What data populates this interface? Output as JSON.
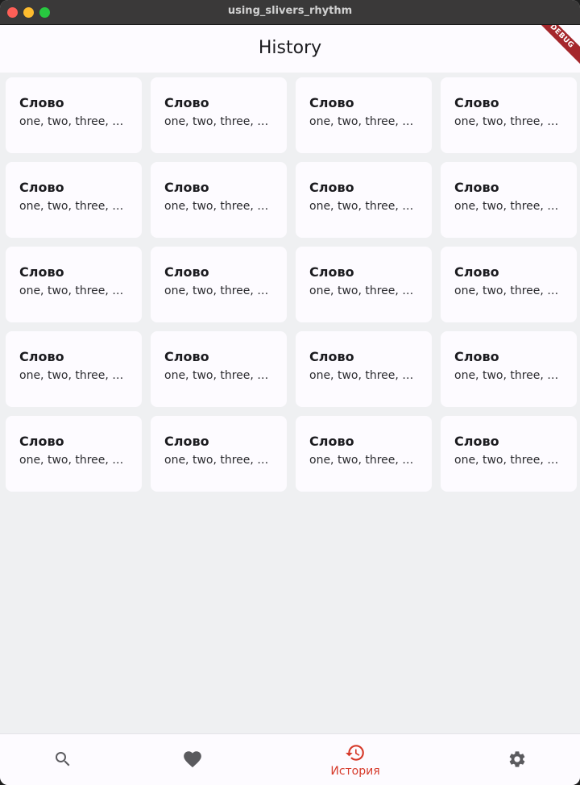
{
  "window": {
    "title": "using_slivers_rhythm"
  },
  "appbar": {
    "title": "History",
    "debug_label": "DEBUG"
  },
  "cards": [
    {
      "title": "Слово",
      "subtitle": "one,  two,  three, four"
    },
    {
      "title": "Слово",
      "subtitle": "one,  two,  three, four"
    },
    {
      "title": "Слово",
      "subtitle": "one,  two,  three, four"
    },
    {
      "title": "Слово",
      "subtitle": "one,  two,  three, four"
    },
    {
      "title": "Слово",
      "subtitle": "one,  two,  three, four"
    },
    {
      "title": "Слово",
      "subtitle": "one,  two,  three, four"
    },
    {
      "title": "Слово",
      "subtitle": "one,  two,  three, four"
    },
    {
      "title": "Слово",
      "subtitle": "one,  two,  three, four"
    },
    {
      "title": "Слово",
      "subtitle": "one,  two,  three, four"
    },
    {
      "title": "Слово",
      "subtitle": "one,  two,  three, four"
    },
    {
      "title": "Слово",
      "subtitle": "one,  two,  three, four"
    },
    {
      "title": "Слово",
      "subtitle": "one,  two,  three, four"
    },
    {
      "title": "Слово",
      "subtitle": "one,  two,  three, four"
    },
    {
      "title": "Слово",
      "subtitle": "one,  two,  three, four"
    },
    {
      "title": "Слово",
      "subtitle": "one,  two,  three, four"
    },
    {
      "title": "Слово",
      "subtitle": "one,  two,  three, four"
    },
    {
      "title": "Слово",
      "subtitle": "one,  two,  three, four"
    },
    {
      "title": "Слово",
      "subtitle": "one,  two,  three, four"
    },
    {
      "title": "Слово",
      "subtitle": "one,  two,  three, four"
    },
    {
      "title": "Слово",
      "subtitle": "one,  two,  three, four"
    }
  ],
  "bottom_nav": {
    "items": [
      {
        "icon": "search-icon",
        "label": "",
        "active": false
      },
      {
        "icon": "heart-icon",
        "label": "",
        "active": false
      },
      {
        "icon": "history-icon",
        "label": "История",
        "active": true
      },
      {
        "icon": "settings-icon",
        "label": "",
        "active": false
      }
    ]
  },
  "colors": {
    "accent": "#d63a2a",
    "icon_inactive": "#5a5a5e",
    "card_bg": "#fdfbff",
    "page_bg": "#eff0f2"
  }
}
